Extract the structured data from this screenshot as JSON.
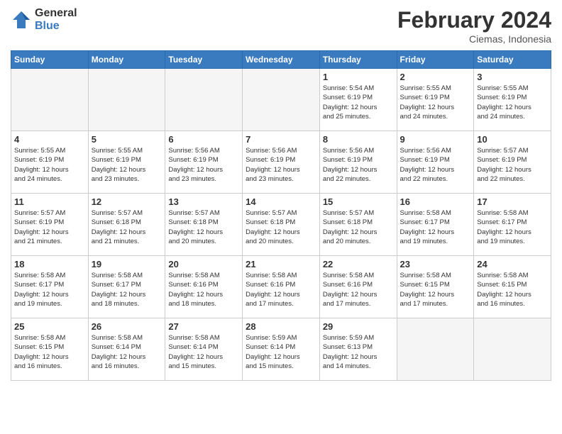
{
  "logo": {
    "general": "General",
    "blue": "Blue"
  },
  "title": "February 2024",
  "location": "Ciemas, Indonesia",
  "days_of_week": [
    "Sunday",
    "Monday",
    "Tuesday",
    "Wednesday",
    "Thursday",
    "Friday",
    "Saturday"
  ],
  "weeks": [
    [
      {
        "day": "",
        "info": ""
      },
      {
        "day": "",
        "info": ""
      },
      {
        "day": "",
        "info": ""
      },
      {
        "day": "",
        "info": ""
      },
      {
        "day": "1",
        "info": "Sunrise: 5:54 AM\nSunset: 6:19 PM\nDaylight: 12 hours\nand 25 minutes."
      },
      {
        "day": "2",
        "info": "Sunrise: 5:55 AM\nSunset: 6:19 PM\nDaylight: 12 hours\nand 24 minutes."
      },
      {
        "day": "3",
        "info": "Sunrise: 5:55 AM\nSunset: 6:19 PM\nDaylight: 12 hours\nand 24 minutes."
      }
    ],
    [
      {
        "day": "4",
        "info": "Sunrise: 5:55 AM\nSunset: 6:19 PM\nDaylight: 12 hours\nand 24 minutes."
      },
      {
        "day": "5",
        "info": "Sunrise: 5:55 AM\nSunset: 6:19 PM\nDaylight: 12 hours\nand 23 minutes."
      },
      {
        "day": "6",
        "info": "Sunrise: 5:56 AM\nSunset: 6:19 PM\nDaylight: 12 hours\nand 23 minutes."
      },
      {
        "day": "7",
        "info": "Sunrise: 5:56 AM\nSunset: 6:19 PM\nDaylight: 12 hours\nand 23 minutes."
      },
      {
        "day": "8",
        "info": "Sunrise: 5:56 AM\nSunset: 6:19 PM\nDaylight: 12 hours\nand 22 minutes."
      },
      {
        "day": "9",
        "info": "Sunrise: 5:56 AM\nSunset: 6:19 PM\nDaylight: 12 hours\nand 22 minutes."
      },
      {
        "day": "10",
        "info": "Sunrise: 5:57 AM\nSunset: 6:19 PM\nDaylight: 12 hours\nand 22 minutes."
      }
    ],
    [
      {
        "day": "11",
        "info": "Sunrise: 5:57 AM\nSunset: 6:19 PM\nDaylight: 12 hours\nand 21 minutes."
      },
      {
        "day": "12",
        "info": "Sunrise: 5:57 AM\nSunset: 6:18 PM\nDaylight: 12 hours\nand 21 minutes."
      },
      {
        "day": "13",
        "info": "Sunrise: 5:57 AM\nSunset: 6:18 PM\nDaylight: 12 hours\nand 20 minutes."
      },
      {
        "day": "14",
        "info": "Sunrise: 5:57 AM\nSunset: 6:18 PM\nDaylight: 12 hours\nand 20 minutes."
      },
      {
        "day": "15",
        "info": "Sunrise: 5:57 AM\nSunset: 6:18 PM\nDaylight: 12 hours\nand 20 minutes."
      },
      {
        "day": "16",
        "info": "Sunrise: 5:58 AM\nSunset: 6:17 PM\nDaylight: 12 hours\nand 19 minutes."
      },
      {
        "day": "17",
        "info": "Sunrise: 5:58 AM\nSunset: 6:17 PM\nDaylight: 12 hours\nand 19 minutes."
      }
    ],
    [
      {
        "day": "18",
        "info": "Sunrise: 5:58 AM\nSunset: 6:17 PM\nDaylight: 12 hours\nand 19 minutes."
      },
      {
        "day": "19",
        "info": "Sunrise: 5:58 AM\nSunset: 6:17 PM\nDaylight: 12 hours\nand 18 minutes."
      },
      {
        "day": "20",
        "info": "Sunrise: 5:58 AM\nSunset: 6:16 PM\nDaylight: 12 hours\nand 18 minutes."
      },
      {
        "day": "21",
        "info": "Sunrise: 5:58 AM\nSunset: 6:16 PM\nDaylight: 12 hours\nand 17 minutes."
      },
      {
        "day": "22",
        "info": "Sunrise: 5:58 AM\nSunset: 6:16 PM\nDaylight: 12 hours\nand 17 minutes."
      },
      {
        "day": "23",
        "info": "Sunrise: 5:58 AM\nSunset: 6:15 PM\nDaylight: 12 hours\nand 17 minutes."
      },
      {
        "day": "24",
        "info": "Sunrise: 5:58 AM\nSunset: 6:15 PM\nDaylight: 12 hours\nand 16 minutes."
      }
    ],
    [
      {
        "day": "25",
        "info": "Sunrise: 5:58 AM\nSunset: 6:15 PM\nDaylight: 12 hours\nand 16 minutes."
      },
      {
        "day": "26",
        "info": "Sunrise: 5:58 AM\nSunset: 6:14 PM\nDaylight: 12 hours\nand 16 minutes."
      },
      {
        "day": "27",
        "info": "Sunrise: 5:58 AM\nSunset: 6:14 PM\nDaylight: 12 hours\nand 15 minutes."
      },
      {
        "day": "28",
        "info": "Sunrise: 5:59 AM\nSunset: 6:14 PM\nDaylight: 12 hours\nand 15 minutes."
      },
      {
        "day": "29",
        "info": "Sunrise: 5:59 AM\nSunset: 6:13 PM\nDaylight: 12 hours\nand 14 minutes."
      },
      {
        "day": "",
        "info": ""
      },
      {
        "day": "",
        "info": ""
      }
    ]
  ]
}
